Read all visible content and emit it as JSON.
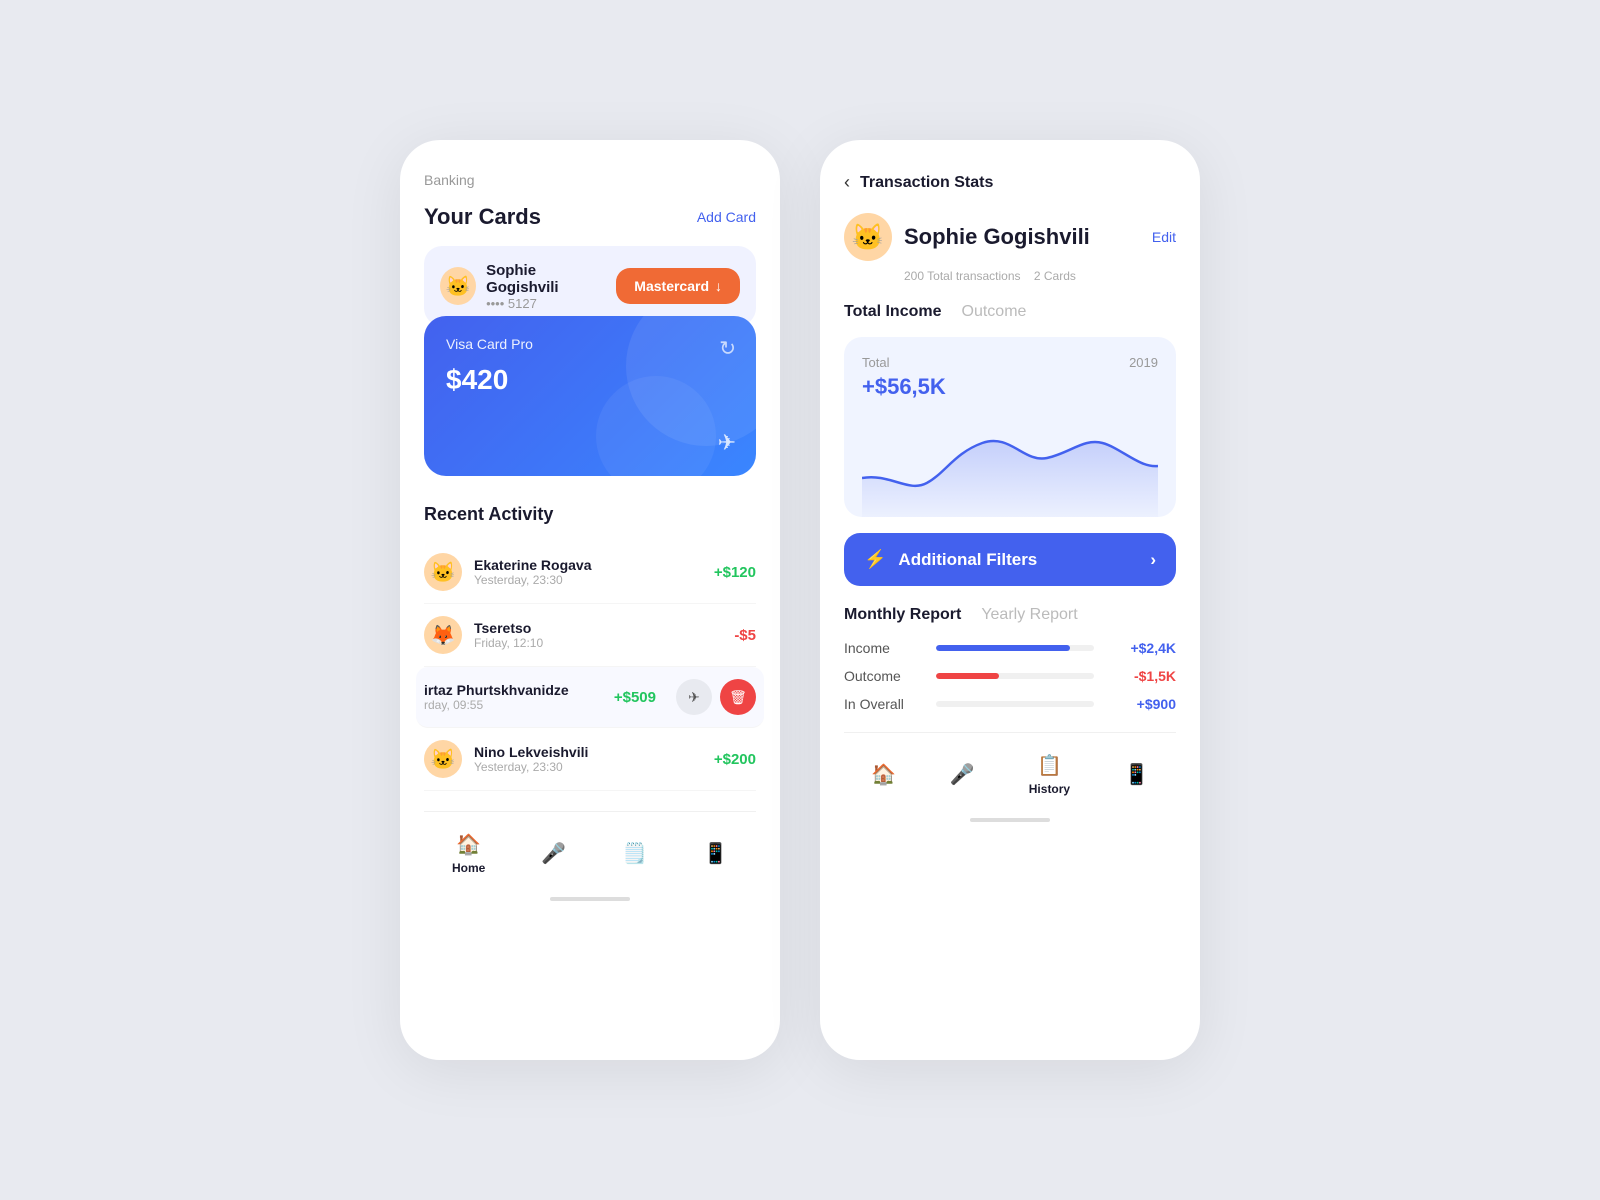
{
  "left_phone": {
    "banking_label": "Banking",
    "your_cards_title": "Your Cards",
    "add_card_btn": "Add Card",
    "card_user": {
      "name": "Sophie Gogishvili",
      "number": "•••• 5127",
      "emoji": "🐱"
    },
    "mastercard_btn": "Mastercard",
    "visa_card": {
      "name": "Visa Card Pro",
      "amount": "$420"
    },
    "recent_activity_title": "Recent Activity",
    "activities": [
      {
        "name": "Ekaterine Rogava",
        "time": "Yesterday, 23:30",
        "amount": "+$120",
        "type": "pos",
        "emoji": "🐱"
      },
      {
        "name": "Tseretso",
        "time": "Friday, 12:10",
        "amount": "-$5",
        "type": "neg",
        "emoji": "🦊"
      },
      {
        "name": "irtaz Phurtskhvanidze",
        "time": "rday, 09:55",
        "amount": "+$509",
        "type": "pos",
        "emoji": null,
        "active": true
      },
      {
        "name": "Nino Lekveishvili",
        "time": "Yesterday, 23:30",
        "amount": "+$200",
        "type": "pos",
        "emoji": "🐱"
      }
    ],
    "nav_items": [
      {
        "label": "Home",
        "icon": "🏠",
        "active": true
      },
      {
        "label": "",
        "icon": "🎤",
        "active": false
      },
      {
        "label": "",
        "icon": "🗒️",
        "active": false
      },
      {
        "label": "",
        "icon": "📱",
        "active": false
      }
    ]
  },
  "right_phone": {
    "back_label": "‹",
    "page_title": "Transaction Stats",
    "profile": {
      "name": "Sophie Gogishvili",
      "emoji": "🐱",
      "total_transactions": "200 Total transactions",
      "cards": "2 Cards",
      "edit_btn": "Edit"
    },
    "tabs": [
      {
        "label": "Total Income",
        "active": true
      },
      {
        "label": "Outcome",
        "active": false
      }
    ],
    "chart": {
      "total_label": "Total",
      "year_label": "2019",
      "value": "+$56,5K"
    },
    "filters_btn": "Additional Filters",
    "report_tabs": [
      {
        "label": "Monthly Report",
        "active": true
      },
      {
        "label": "Yearly Report",
        "active": false
      }
    ],
    "report_items": [
      {
        "label": "Income",
        "amount": "+$2,4K",
        "type": "pos",
        "bar_type": "income",
        "bar_width": "85"
      },
      {
        "label": "Outcome",
        "amount": "-$1,5K",
        "type": "neg",
        "bar_type": "outcome",
        "bar_width": "40"
      },
      {
        "label": "In Overall",
        "amount": "+$900",
        "type": "overall",
        "bar_type": null,
        "bar_width": "0"
      }
    ],
    "nav_items": [
      {
        "label": "",
        "icon": "🏠",
        "active": false
      },
      {
        "label": "",
        "icon": "🎤",
        "active": false
      },
      {
        "label": "History",
        "icon": "📋",
        "active": true
      },
      {
        "label": "",
        "icon": "📱",
        "active": false
      }
    ]
  },
  "colors": {
    "primary": "#4361ee",
    "danger": "#ef4444",
    "success": "#22c55e",
    "orange": "#f06a35"
  }
}
